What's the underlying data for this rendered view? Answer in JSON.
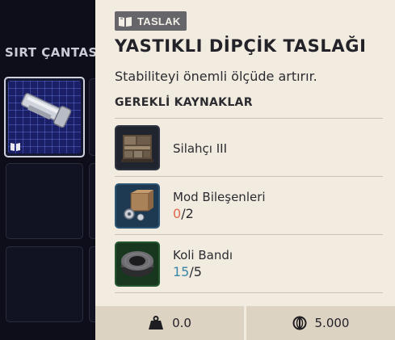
{
  "backpack": {
    "title": "SIRT ÇANTASI"
  },
  "tooltip": {
    "badge_label": "TASLAK",
    "badge_icon": "book-icon",
    "title": "YASTIKLI DİPÇİK TASLAĞI",
    "description": "Stabiliteyi önemli ölçüde artırır.",
    "requirements_heading": "GEREKLİ KAYNAKLAR",
    "requirements": [
      {
        "name": "Silahçı III",
        "icon": "workbench-icon"
      },
      {
        "name": "Mod Bileşenleri",
        "have": "0",
        "need": "/2",
        "icon": "mod-components-icon",
        "status_color": "#e0694f"
      },
      {
        "name": "Koli Bandı",
        "have": "15",
        "need": "/5",
        "icon": "duct-tape-icon",
        "status_color": "#3a86a8"
      }
    ],
    "footer": {
      "weight": "0.0",
      "weight_icon": "weight-icon",
      "value": "5.000",
      "value_icon": "coin-icon"
    }
  }
}
